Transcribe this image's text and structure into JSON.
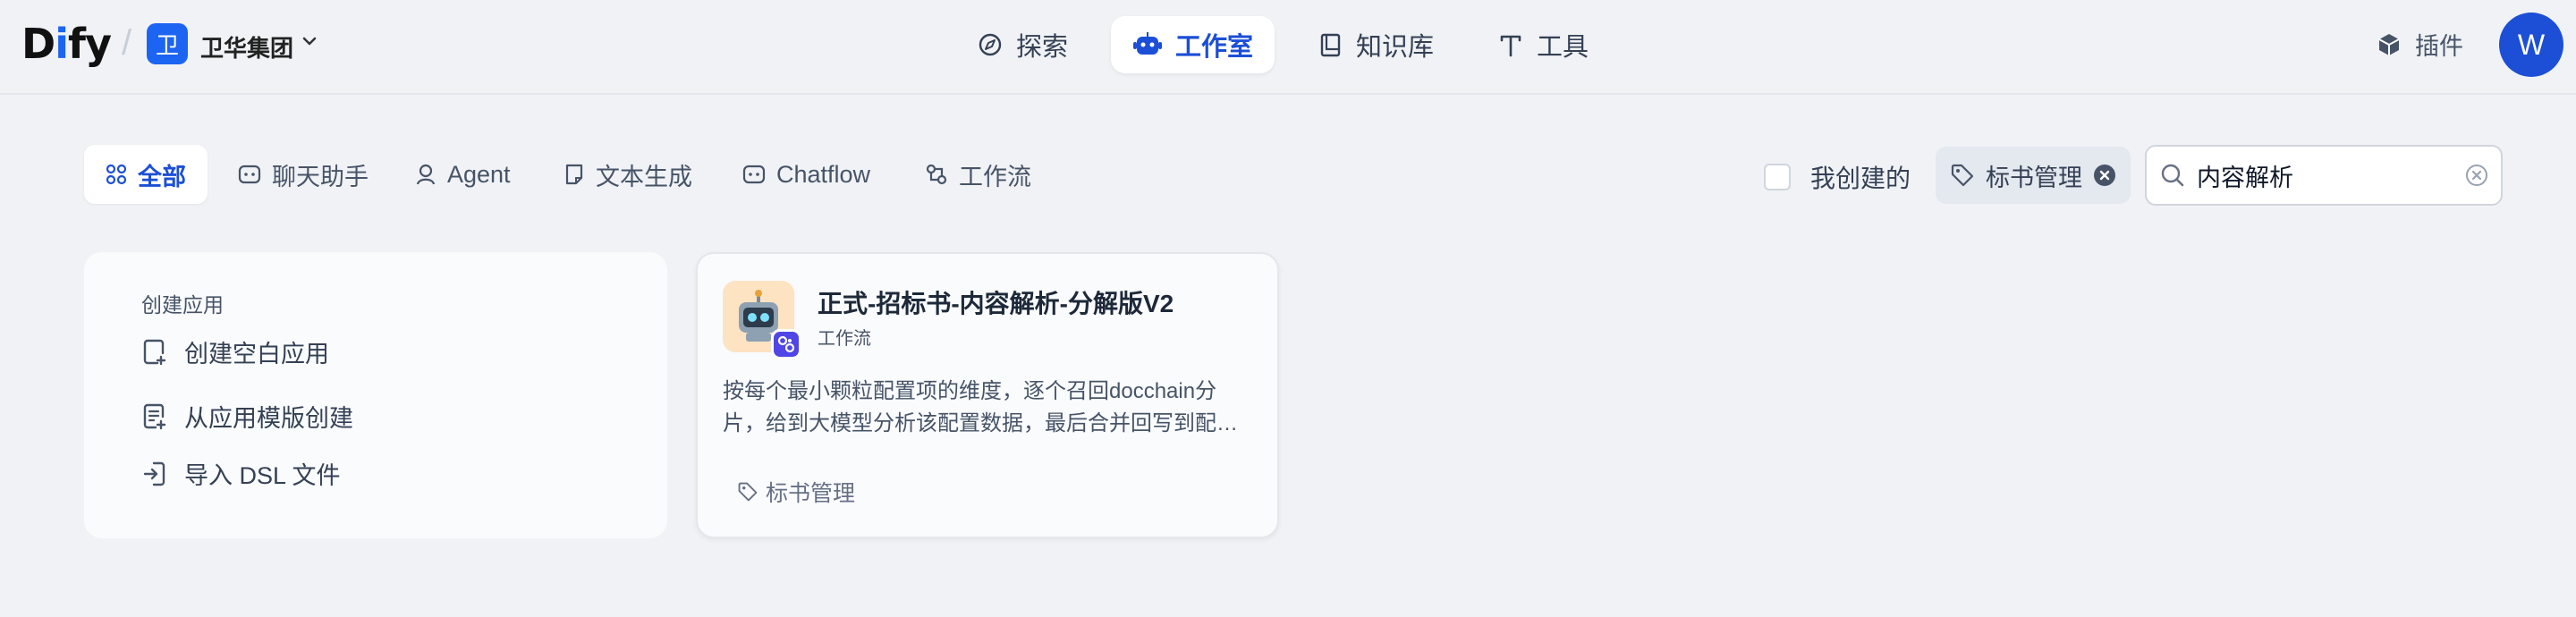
{
  "header": {
    "logo_prefix": "D",
    "logo_accent": "i",
    "logo_suffix": "fy",
    "workspace_initial": "卫",
    "workspace_name": "卫华集团",
    "nav": {
      "explore": "探索",
      "studio": "工作室",
      "knowledge": "知识库",
      "tools": "工具"
    },
    "plugins": "插件",
    "avatar_initial": "W"
  },
  "filters": {
    "tabs": {
      "all": "全部",
      "chat": "聊天助手",
      "agent": "Agent",
      "completion": "文本生成",
      "chatflow": "Chatflow",
      "workflow": "工作流"
    },
    "created_by_me": "我创建的",
    "tag_filter": "标书管理",
    "search_value": "内容解析"
  },
  "create_card": {
    "title": "创建应用",
    "blank": "创建空白应用",
    "template": "从应用模版创建",
    "import_dsl": "导入 DSL 文件"
  },
  "apps": [
    {
      "name": "正式-招标书-内容解析-分解版V2",
      "type": "工作流",
      "description_line1": "按每个最小颗粒配置项的维度，逐个召回docchain分",
      "description_line2": "片，给到大模型分析该配置数据，最后合并回写到配置项中",
      "tag": "标书管理"
    }
  ],
  "colors": {
    "accent": "#1c4fd6",
    "brand_blue": "#1c64f2",
    "background": "#f0f2f6",
    "app_icon_bg": "#fde3c2",
    "workflow_badge": "#4f46e5"
  }
}
